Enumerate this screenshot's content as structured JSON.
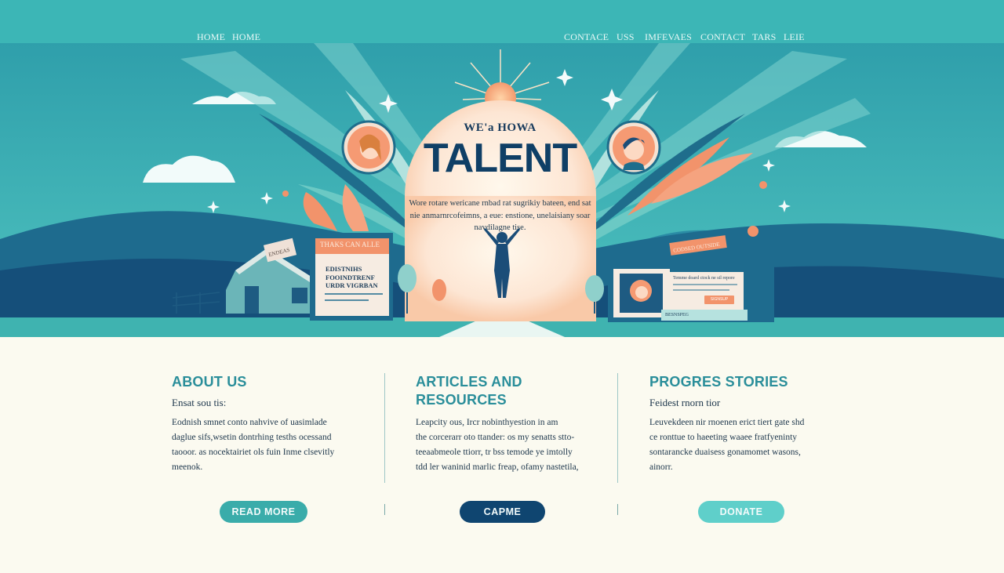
{
  "nav": {
    "left_items": [
      "HOME",
      "HOME"
    ],
    "right_items": [
      "CONTACE",
      "USS",
      "IMFEVAES",
      "CONTACT",
      "TARS",
      "LEIE"
    ]
  },
  "hero": {
    "eyebrow": "WE'a HOWA",
    "title": "TALENT",
    "description": "Wore rotare wericane rnbad rat sugrikiy bateen, end sat nie anmarnrcofeimns, a eue: enstione, unelaisiany soar navdilagne tise.",
    "card_left": {
      "title": "THAKS CAN ALLE",
      "body": "EDISTNIHS FOOINDTRENF URDR VIGRBAN"
    },
    "tag_left": "ENDEAS",
    "tag_right": "CODSED OUTSIDE",
    "card_right": {
      "text": "Temme doard ctock ne sil repore",
      "button": "SIGNSUP",
      "footer": "BESNSPEG"
    }
  },
  "sections": [
    {
      "title": "ABOUT US",
      "subtitle": "Ensat sou tis:",
      "lines": [
        "Eodnish smnet conto nahvive of uasimlade",
        "daglue sifs,wsetin dontrhing tesths ocessand",
        "taooor. as nocektairiet ols fuin Inme clsevitly",
        "meenok."
      ],
      "button": "READ MORE"
    },
    {
      "title": "ARTICLES AND",
      "title2": "RESOURCES",
      "subtitle": "",
      "lines": [
        "Leapcity ous, Ircr nobinthyestion in am",
        "the corcerarr oto ttander: os my senatts stto-",
        "teeaabmeole ttiorr, tr bss temode ye imtolly",
        "tdd ler waninid marlic freap, ofamy nastetila,"
      ],
      "button": "CAPME"
    },
    {
      "title": "PROGRES STORIES",
      "subtitle": "Feidest rnorn tior",
      "lines": [
        "Leuvekdeen nir rnoenen erict tiert gate shd",
        "ce ronttue to haeeting waaee fratfyeninty",
        "sontarancke duaisess gonamomet wasons,",
        "ainorr."
      ],
      "button": "DONATE"
    }
  ],
  "colors": {
    "nav": "#3cb6b6",
    "teal_heading": "#2a8e9a",
    "navy": "#0f3f66",
    "button_teal": "#3aacaa",
    "button_navy": "#0f4570",
    "button_mint": "#5fcfca",
    "accent_orange": "#f2936b",
    "background": "#fbfaf0"
  }
}
